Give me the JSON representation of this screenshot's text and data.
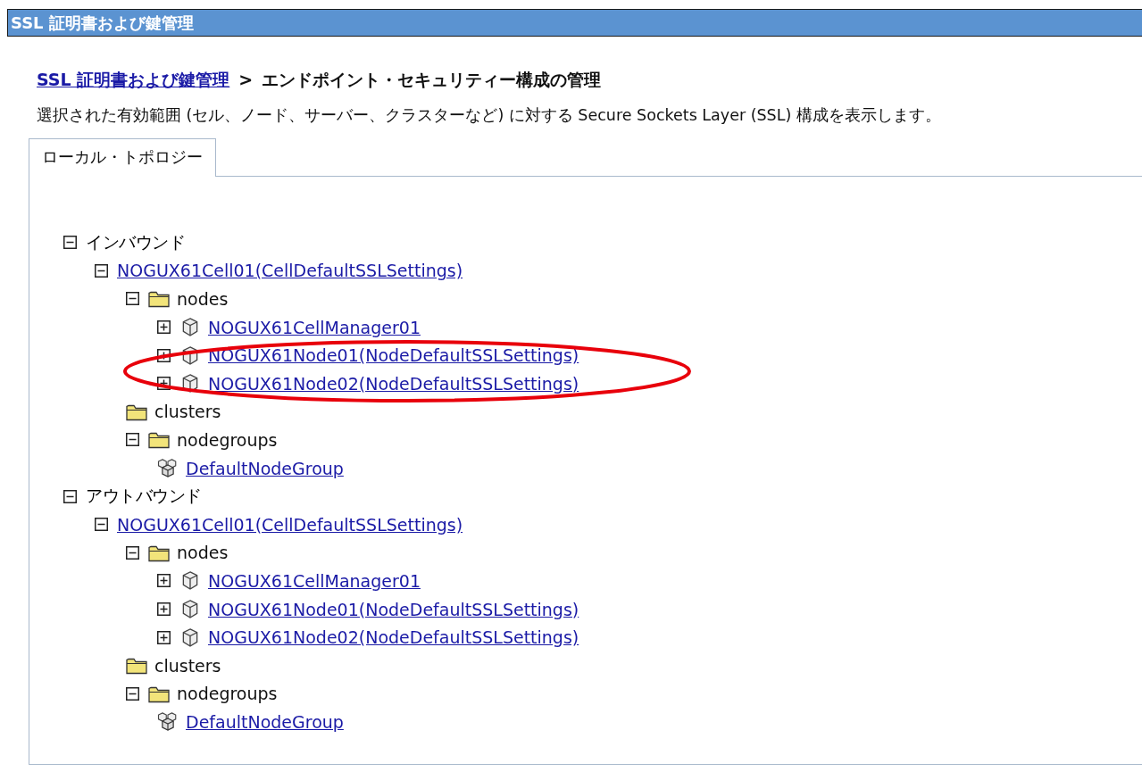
{
  "header": {
    "title": "SSL 証明書および鍵管理"
  },
  "breadcrumb": {
    "link": "SSL 証明書および鍵管理",
    "separator": ">",
    "current": "エンドポイント・セキュリティー構成の管理"
  },
  "description": "選択された有効範囲 (セル、ノード、サーバー、クラスターなど) に対する Secure Sockets Layer (SSL) 構成を表示します。",
  "tabs": [
    {
      "label": "ローカル・トポロジー",
      "selected": true
    }
  ],
  "tree": [
    {
      "label": "インバウンド",
      "kind": "group",
      "expanded": true,
      "children": [
        {
          "label": "NOGUX61Cell01(CellDefaultSSLSettings)",
          "kind": "cell",
          "expanded": true,
          "children": [
            {
              "label": "nodes",
              "kind": "folder",
              "expanded": true,
              "children": [
                {
                  "label": "NOGUX61CellManager01",
                  "kind": "server",
                  "expanded": false
                },
                {
                  "label": "NOGUX61Node01(NodeDefaultSSLSettings)",
                  "kind": "server",
                  "expanded": false
                },
                {
                  "label": "NOGUX61Node02(NodeDefaultSSLSettings)",
                  "kind": "server",
                  "expanded": false
                }
              ]
            },
            {
              "label": "clusters",
              "kind": "folder"
            },
            {
              "label": "nodegroups",
              "kind": "folder",
              "expanded": true,
              "children": [
                {
                  "label": "DefaultNodeGroup",
                  "kind": "nodegroup"
                }
              ]
            }
          ]
        }
      ]
    },
    {
      "label": "アウトバウンド",
      "kind": "group",
      "expanded": true,
      "children": [
        {
          "label": "NOGUX61Cell01(CellDefaultSSLSettings)",
          "kind": "cell",
          "expanded": true,
          "children": [
            {
              "label": "nodes",
              "kind": "folder",
              "expanded": true,
              "children": [
                {
                  "label": "NOGUX61CellManager01",
                  "kind": "server",
                  "expanded": false
                },
                {
                  "label": "NOGUX61Node01(NodeDefaultSSLSettings)",
                  "kind": "server",
                  "expanded": false
                },
                {
                  "label": "NOGUX61Node02(NodeDefaultSSLSettings)",
                  "kind": "server",
                  "expanded": false
                }
              ]
            },
            {
              "label": "clusters",
              "kind": "folder"
            },
            {
              "label": "nodegroups",
              "kind": "folder",
              "expanded": true,
              "children": [
                {
                  "label": "DefaultNodeGroup",
                  "kind": "nodegroup"
                }
              ]
            }
          ]
        }
      ]
    }
  ]
}
